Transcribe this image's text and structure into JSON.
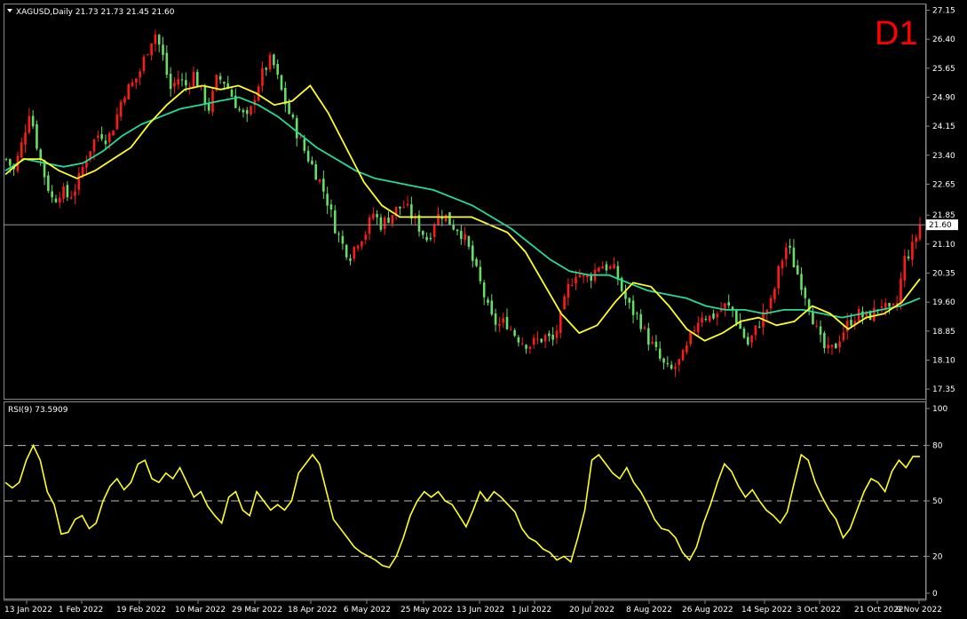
{
  "chart_data": [
    {
      "type": "candlestick",
      "symbol_header": "XAGUSD,Daily  21.73 21.73 21.45 21.60",
      "timeframe_badge": "D1",
      "current_price_label": "21.60",
      "current_price": 21.6,
      "ylim": [
        17.1,
        27.3
      ],
      "y_ticks": [
        "27.15",
        "26.40",
        "25.65",
        "24.90",
        "24.15",
        "23.40",
        "22.65",
        "21.85",
        "21.10",
        "20.35",
        "19.60",
        "18.85",
        "18.10",
        "17.35"
      ],
      "x_ticks": [
        "13 Jan 2022",
        "1 Feb 2022",
        "19 Feb 2022",
        "10 Mar 2022",
        "29 Mar 2022",
        "18 Apr 2022",
        "6 May 2022",
        "25 May 2022",
        "13 Jun 2022",
        "1 Jul 2022",
        "20 Jul 2022",
        "8 Aug 2022",
        "26 Aug 2022",
        "14 Sep 2022",
        "3 Oct 2022",
        "21 Oct 2022",
        "9 Nov 2022"
      ],
      "colors": {
        "bull": "#ff1a1a",
        "bear": "#66dd66",
        "ma_fast": "#ffff22",
        "ma_slow": "#22dd99",
        "badge": "#ff0000"
      },
      "close_path": [
        23.3,
        23.0,
        23.7,
        24.6,
        23.6,
        22.8,
        22.2,
        22.5,
        22.3,
        22.6,
        23.2,
        23.7,
        24.0,
        23.8,
        24.3,
        25.0,
        25.2,
        25.5,
        26.1,
        26.6,
        26.0,
        25.1,
        25.4,
        25.2,
        25.5,
        25.0,
        24.6,
        25.4,
        25.3,
        24.9,
        24.5,
        24.3,
        25.1,
        25.6,
        25.9,
        25.2,
        24.6,
        24.1,
        23.6,
        23.2,
        22.8,
        22.3,
        21.6,
        21.1,
        20.8,
        21.2,
        21.4,
        21.9,
        21.6,
        21.8,
        22.0,
        22.1,
        21.8,
        21.5,
        21.2,
        21.8,
        21.9,
        21.6,
        21.5,
        21.1,
        20.5,
        19.9,
        19.2,
        19.0,
        19.1,
        18.8,
        18.6,
        18.5,
        18.6,
        18.7,
        18.6,
        19.2,
        20.0,
        20.4,
        20.2,
        20.3,
        20.6,
        20.5,
        20.4,
        19.8,
        19.4,
        19.2,
        18.7,
        18.4,
        18.0,
        17.8,
        18.0,
        18.3,
        18.9,
        19.3,
        19.2,
        19.3,
        19.5,
        19.4,
        18.9,
        18.5,
        18.9,
        19.3,
        19.6,
        20.5,
        21.1,
        20.5,
        20.0,
        19.4,
        18.7,
        18.3,
        18.4,
        18.8,
        19.1,
        19.3,
        19.2,
        19.3,
        19.6,
        19.3,
        19.5,
        20.7,
        21.0,
        21.6
      ],
      "ma_fast_path": [
        22.9,
        23.3,
        23.3,
        23.0,
        22.8,
        23.0,
        23.3,
        23.6,
        24.2,
        24.7,
        25.1,
        25.2,
        25.1,
        25.2,
        25.0,
        24.7,
        24.8,
        25.2,
        24.5,
        23.6,
        22.7,
        22.1,
        21.8,
        21.8,
        21.8,
        21.8,
        21.8,
        21.6,
        21.4,
        20.9,
        20.1,
        19.3,
        18.8,
        19.0,
        19.6,
        20.1,
        20.0,
        19.5,
        18.9,
        18.6,
        18.8,
        19.1,
        19.2,
        19.0,
        19.1,
        19.5,
        19.3,
        18.9,
        19.2,
        19.3,
        19.6,
        20.2
      ],
      "ma_slow_path": [
        23.0,
        23.3,
        23.2,
        23.1,
        23.2,
        23.5,
        23.9,
        24.2,
        24.4,
        24.6,
        24.7,
        24.8,
        24.9,
        24.7,
        24.4,
        24.0,
        23.6,
        23.3,
        23.0,
        22.8,
        22.7,
        22.6,
        22.5,
        22.3,
        22.1,
        21.8,
        21.5,
        21.1,
        20.7,
        20.4,
        20.3,
        20.3,
        20.1,
        19.9,
        19.8,
        19.7,
        19.5,
        19.4,
        19.4,
        19.3,
        19.4,
        19.4,
        19.3,
        19.2,
        19.3,
        19.4,
        19.5,
        19.7
      ]
    },
    {
      "type": "line",
      "title": "RSI(9) 73.5909",
      "ylim": [
        0,
        100
      ],
      "y_ticks": [
        "100",
        "80",
        "50",
        "20",
        "0"
      ],
      "levels": [
        80,
        50,
        20
      ],
      "color": "#ffff22",
      "values": [
        60,
        57,
        60,
        72,
        80,
        72,
        55,
        48,
        32,
        33,
        40,
        42,
        35,
        38,
        50,
        58,
        62,
        56,
        60,
        70,
        72,
        62,
        60,
        65,
        62,
        68,
        60,
        52,
        55,
        47,
        42,
        38,
        52,
        55,
        45,
        42,
        55,
        50,
        45,
        48,
        45,
        50,
        65,
        70,
        75,
        70,
        55,
        40,
        35,
        30,
        25,
        22,
        20,
        18,
        15,
        14,
        20,
        30,
        42,
        50,
        55,
        52,
        55,
        50,
        48,
        42,
        36,
        45,
        55,
        50,
        55,
        52,
        48,
        44,
        35,
        30,
        28,
        24,
        22,
        18,
        20,
        17,
        30,
        45,
        72,
        75,
        70,
        65,
        62,
        68,
        60,
        55,
        48,
        40,
        35,
        34,
        30,
        22,
        18,
        25,
        38,
        48,
        60,
        70,
        66,
        58,
        52,
        56,
        50,
        45,
        42,
        38,
        44,
        60,
        75,
        72,
        60,
        52,
        45,
        40,
        30,
        35,
        45,
        55,
        62,
        60,
        55,
        66,
        72,
        68,
        74,
        74
      ]
    }
  ]
}
